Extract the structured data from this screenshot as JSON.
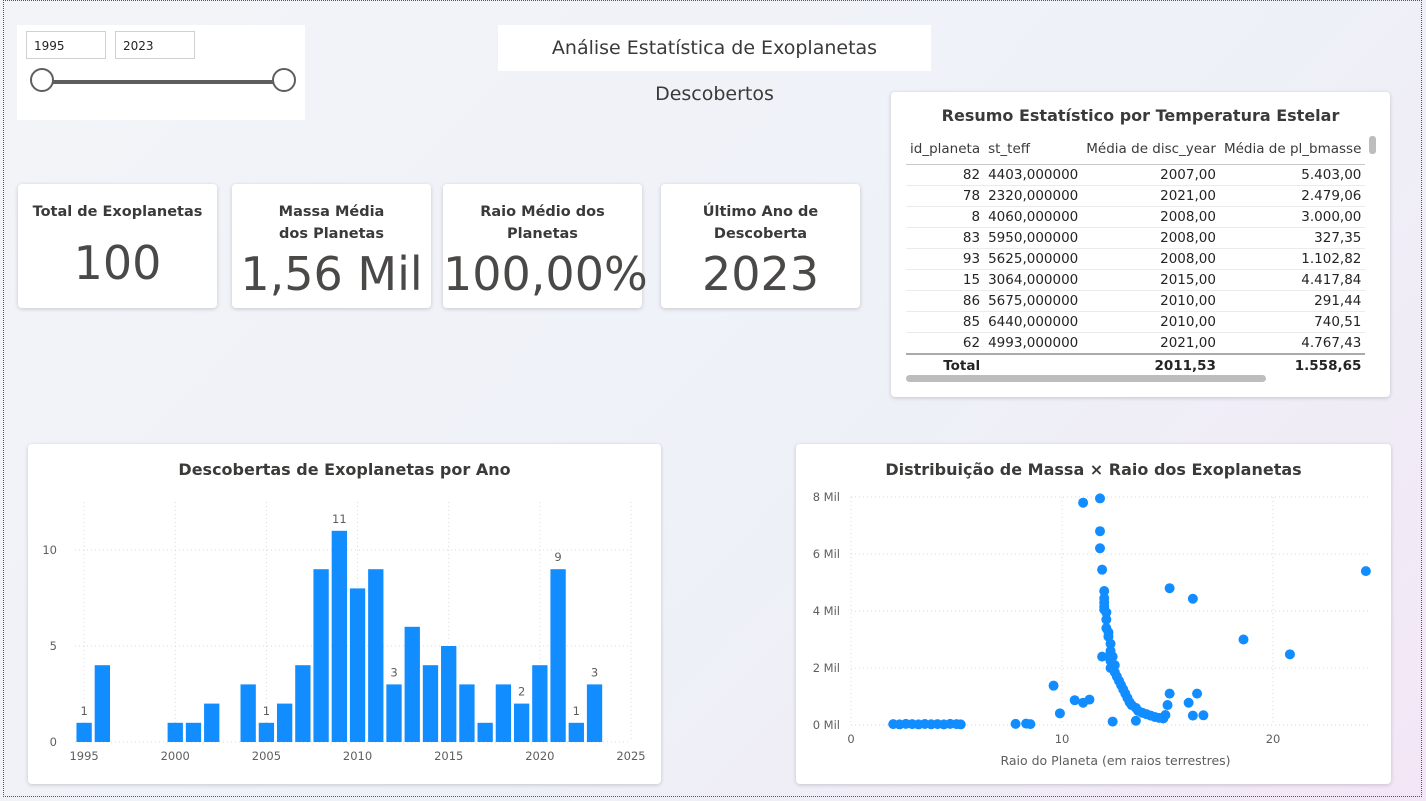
{
  "slicer": {
    "start": "1995",
    "end": "2023"
  },
  "report_title": "Análise Estatística de Exoplanetas Descobertos",
  "kpis": [
    {
      "title": "Total de Exoplanetas",
      "value": "100"
    },
    {
      "title": "Massa Média dos Planetas",
      "value": "1,56 Mil"
    },
    {
      "title": "Raio Médio dos Planetas",
      "value": "100,00%"
    },
    {
      "title": "Último Ano de Descoberta",
      "value": "2023"
    }
  ],
  "table": {
    "title": "Resumo Estatístico por Temperatura Estelar",
    "columns": [
      "id_planeta",
      "st_teff",
      "Média de disc_year",
      "Média de pl_bmasse"
    ],
    "rows": [
      [
        "82",
        "4403,000000",
        "2007,00",
        "5.403,00"
      ],
      [
        "78",
        "2320,000000",
        "2021,00",
        "2.479,06"
      ],
      [
        "8",
        "4060,000000",
        "2008,00",
        "3.000,00"
      ],
      [
        "83",
        "5950,000000",
        "2008,00",
        "327,35"
      ],
      [
        "93",
        "5625,000000",
        "2008,00",
        "1.102,82"
      ],
      [
        "15",
        "3064,000000",
        "2015,00",
        "4.417,84"
      ],
      [
        "86",
        "5675,000000",
        "2010,00",
        "291,44"
      ],
      [
        "85",
        "6440,000000",
        "2010,00",
        "740,51"
      ],
      [
        "62",
        "4993,000000",
        "2021,00",
        "4.767,43"
      ]
    ],
    "total": {
      "label": "Total",
      "disc_year": "2011,53",
      "pl_bmasse": "1.558,65"
    }
  },
  "bar_chart": {
    "title": "Descobertas de Exoplanetas por Ano"
  },
  "scatter_chart": {
    "title": "Distribuição de Massa × Raio dos Exoplanetas"
  },
  "colors": {
    "accent": "#118DFF"
  },
  "chart_data": [
    {
      "type": "bar",
      "title": "Descobertas de Exoplanetas por Ano",
      "x": [
        1995,
        1996,
        2000,
        2001,
        2002,
        2004,
        2005,
        2006,
        2007,
        2008,
        2009,
        2010,
        2011,
        2012,
        2013,
        2014,
        2015,
        2016,
        2017,
        2018,
        2019,
        2020,
        2021,
        2022,
        2023
      ],
      "values": [
        1,
        4,
        1,
        1,
        2,
        3,
        1,
        2,
        4,
        9,
        11,
        8,
        9,
        3,
        6,
        4,
        5,
        3,
        1,
        3,
        2,
        4,
        9,
        1,
        3
      ],
      "data_labels": {
        "1995": "1",
        "2005": "1",
        "2009": "11",
        "2012": "3",
        "2019": "2",
        "2021": "9",
        "2022": "1",
        "2023": "3"
      },
      "x_ticks": [
        "1995",
        "2000",
        "2005",
        "2010",
        "2015",
        "2020",
        "2025"
      ],
      "y_ticks": [
        "0",
        "5",
        "10"
      ],
      "xlim": [
        1994.5,
        2025
      ],
      "ylim": [
        0,
        12.5
      ],
      "grid": true
    },
    {
      "type": "scatter",
      "title": "Distribuição de Massa × Raio dos Exoplanetas",
      "xlabel": "Raio do Planeta (em raios terrestres)",
      "ylabel": "",
      "x_ticks": [
        "0",
        "10",
        "20"
      ],
      "y_ticks": [
        "0 Mil",
        "2 Mil",
        "4 Mil",
        "6 Mil",
        "8 Mil"
      ],
      "xlim": [
        0,
        24.5
      ],
      "ylim": [
        0,
        8000
      ],
      "grid": true,
      "points": [
        [
          2.0,
          30
        ],
        [
          2.3,
          20
        ],
        [
          2.6,
          40
        ],
        [
          2.9,
          30
        ],
        [
          3.2,
          20
        ],
        [
          3.5,
          35
        ],
        [
          3.8,
          25
        ],
        [
          4.1,
          30
        ],
        [
          4.4,
          20
        ],
        [
          4.7,
          40
        ],
        [
          5.0,
          30
        ],
        [
          5.2,
          20
        ],
        [
          7.8,
          40
        ],
        [
          8.3,
          50
        ],
        [
          8.5,
          30
        ],
        [
          9.6,
          1380
        ],
        [
          9.9,
          410
        ],
        [
          10.6,
          870
        ],
        [
          11.0,
          780
        ],
        [
          11.3,
          890
        ],
        [
          11.0,
          7800
        ],
        [
          11.8,
          7950
        ],
        [
          11.8,
          6800
        ],
        [
          11.8,
          6200
        ],
        [
          11.9,
          5450
        ],
        [
          12.0,
          4700
        ],
        [
          12.0,
          4450
        ],
        [
          12.0,
          4300
        ],
        [
          12.0,
          4150
        ],
        [
          12.0,
          4050
        ],
        [
          12.1,
          3950
        ],
        [
          12.1,
          3700
        ],
        [
          12.1,
          3400
        ],
        [
          12.2,
          3250
        ],
        [
          12.2,
          3100
        ],
        [
          12.3,
          2850
        ],
        [
          12.3,
          2600
        ],
        [
          12.3,
          2500
        ],
        [
          12.4,
          2400
        ],
        [
          11.9,
          2400
        ],
        [
          12.3,
          2250
        ],
        [
          12.5,
          2100
        ],
        [
          12.3,
          2000
        ],
        [
          12.5,
          1850
        ],
        [
          12.6,
          1700
        ],
        [
          12.7,
          1550
        ],
        [
          12.8,
          1400
        ],
        [
          12.9,
          1250
        ],
        [
          13.0,
          1100
        ],
        [
          13.1,
          950
        ],
        [
          13.2,
          800
        ],
        [
          13.3,
          700
        ],
        [
          13.5,
          600
        ],
        [
          13.6,
          500
        ],
        [
          13.8,
          430
        ],
        [
          14.0,
          380
        ],
        [
          14.2,
          330
        ],
        [
          14.4,
          280
        ],
        [
          14.6,
          250
        ],
        [
          14.8,
          230
        ],
        [
          14.9,
          350
        ],
        [
          15.0,
          700
        ],
        [
          15.1,
          1100
        ],
        [
          12.4,
          120
        ],
        [
          13.5,
          150
        ],
        [
          15.1,
          4800
        ],
        [
          16.2,
          4430
        ],
        [
          16.0,
          780
        ],
        [
          16.2,
          330
        ],
        [
          16.4,
          1100
        ],
        [
          16.7,
          340
        ],
        [
          18.6,
          3000
        ],
        [
          20.8,
          2480
        ],
        [
          24.4,
          5400
        ]
      ]
    }
  ]
}
